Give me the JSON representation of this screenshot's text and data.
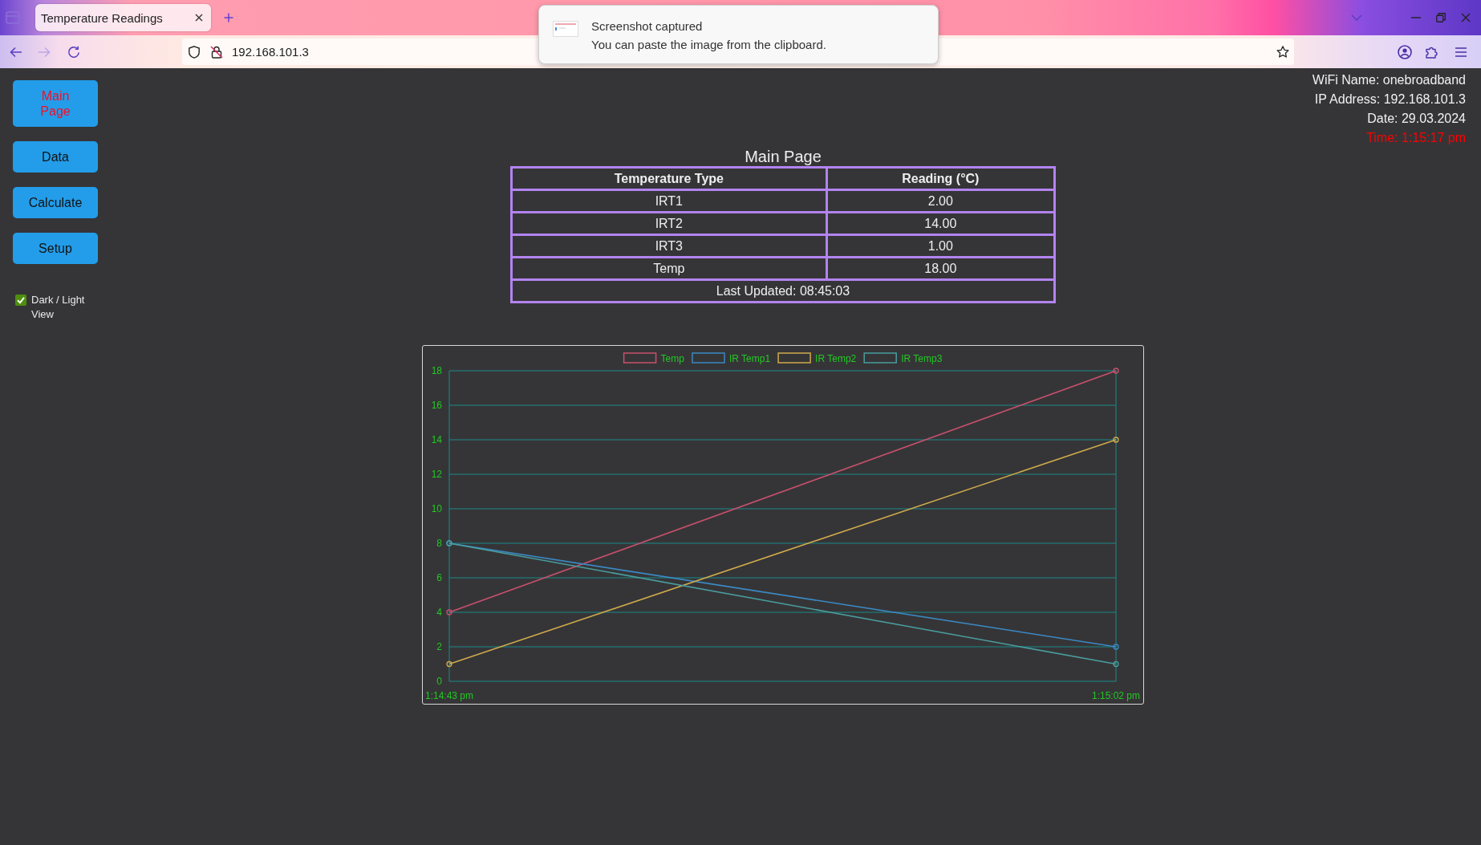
{
  "browser": {
    "tabs": [
      {
        "title": "Temperature Readings",
        "selected": true
      }
    ],
    "forward_disabled": true,
    "address": "192.168.101.3"
  },
  "notification": {
    "title": "Screenshot captured",
    "message": "You can paste the image from the clipboard."
  },
  "sidebar": {
    "items": [
      {
        "label": "Main Page",
        "selected": true
      },
      {
        "label": "Data",
        "selected": false
      },
      {
        "label": "Calculate",
        "selected": false
      },
      {
        "label": "Setup",
        "selected": false
      }
    ],
    "theme_toggle": {
      "label": "Dark / Light View",
      "checked": true
    }
  },
  "device_info": {
    "wifi_name": "WiFi Name: onebroadband",
    "ip_address": "IP Address: 192.168.101.3",
    "date": "Date: 29.03.2024",
    "time": "Time: 1:15:17 pm"
  },
  "main": {
    "title": "Main Page",
    "table": {
      "columns": [
        "Temperature Type",
        "Reading (°C)"
      ],
      "rows": [
        [
          "IRT1",
          "2.00"
        ],
        [
          "IRT2",
          "14.00"
        ],
        [
          "IRT3",
          "1.00"
        ],
        [
          "Temp",
          "18.00"
        ]
      ],
      "footer": "Last Updated: 08:45:03"
    }
  },
  "chart": {
    "chart_data": {
      "type": "line",
      "legend": "top",
      "categories": [
        "1:14:43 pm",
        "1:15:02 pm"
      ],
      "series": [
        {
          "name": "Temp",
          "color": "#c9506e",
          "marker": "circle",
          "values": [
            4,
            18
          ]
        },
        {
          "name": "IR Temp1",
          "color": "#3b89c4",
          "marker": "circle",
          "values": [
            8,
            2
          ]
        },
        {
          "name": "IR Temp2",
          "color": "#cfaa4c",
          "marker": "circle",
          "values": [
            1,
            14
          ]
        },
        {
          "name": "IR Temp3",
          "color": "#4a9d9f",
          "marker": "circle",
          "values": [
            8,
            1
          ]
        }
      ],
      "ylim": [
        0,
        18
      ],
      "yticks": [
        0,
        2,
        4,
        6,
        8,
        10,
        12,
        14,
        16,
        18
      ],
      "ref_lines": [
        {
          "axis": "y",
          "value": 2
        },
        {
          "axis": "y",
          "value": 4
        },
        {
          "axis": "y",
          "value": 6
        },
        {
          "axis": "y",
          "value": 8
        },
        {
          "axis": "y",
          "value": 10
        },
        {
          "axis": "y",
          "value": 12
        },
        {
          "axis": "y",
          "value": 14
        },
        {
          "axis": "y",
          "value": 16
        }
      ]
    }
  }
}
